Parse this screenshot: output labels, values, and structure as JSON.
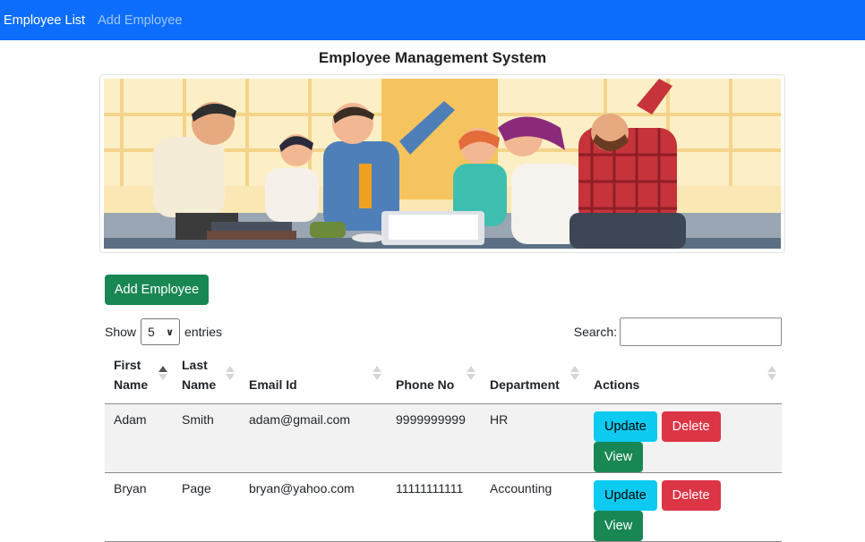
{
  "navbar": {
    "brand": "Employee List",
    "links": [
      {
        "label": "Add Employee"
      }
    ]
  },
  "page": {
    "title": "Employee Management System"
  },
  "banner": {
    "description_icon": "team-celebration-illustration"
  },
  "toolbar": {
    "add_label": "Add Employee"
  },
  "datatable": {
    "show_label": "Show",
    "entries_value": "5",
    "entries_label": "entries",
    "search_label": "Search:",
    "search_value": ""
  },
  "table": {
    "headers": [
      {
        "line1": "First",
        "line2": "Name"
      },
      {
        "line1": "Last",
        "line2": "Name"
      },
      {
        "line1": "",
        "line2": "Email Id"
      },
      {
        "line1": "",
        "line2": "Phone No"
      },
      {
        "line1": "",
        "line2": "Department"
      },
      {
        "line1": "",
        "line2": "Actions"
      }
    ],
    "rows": [
      {
        "first": "Adam",
        "last": "Smith",
        "email": "adam@gmail.com",
        "phone": "9999999999",
        "department": "HR"
      },
      {
        "first": "Bryan",
        "last": "Page",
        "email": "bryan@yahoo.com",
        "phone": "11111111111",
        "department": "Accounting"
      }
    ],
    "actions": {
      "update": "Update",
      "delete": "Delete",
      "view": "View"
    }
  },
  "colors": {
    "navbar": "#0d6efd",
    "success": "#198754",
    "info": "#0dcaf0",
    "danger": "#dc3545"
  }
}
